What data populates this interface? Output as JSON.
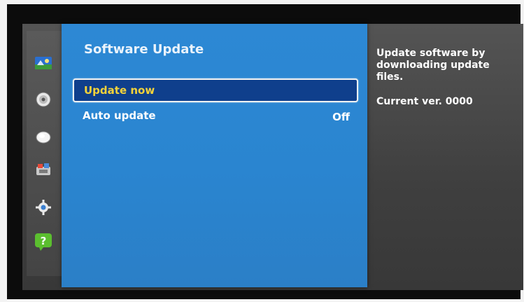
{
  "panel": {
    "title": "Software Update",
    "items": [
      {
        "label": "Update now",
        "value": "",
        "selected": true
      },
      {
        "label": "Auto update",
        "value": "Off",
        "selected": false
      }
    ]
  },
  "info": {
    "description": "Update software by\ndownloading update\nfiles.",
    "version": "Current ver. 0000"
  },
  "sidebar": {
    "icons": [
      "picture-icon",
      "sound-icon",
      "broadcast-icon",
      "applications-icon",
      "system-gear-icon",
      "support-help-icon"
    ]
  },
  "colors": {
    "panel_blue": "#2a85d0",
    "selected_bg": "#0f3f8c",
    "selected_text": "#f4d33a",
    "help_green": "#5bbf2f"
  }
}
